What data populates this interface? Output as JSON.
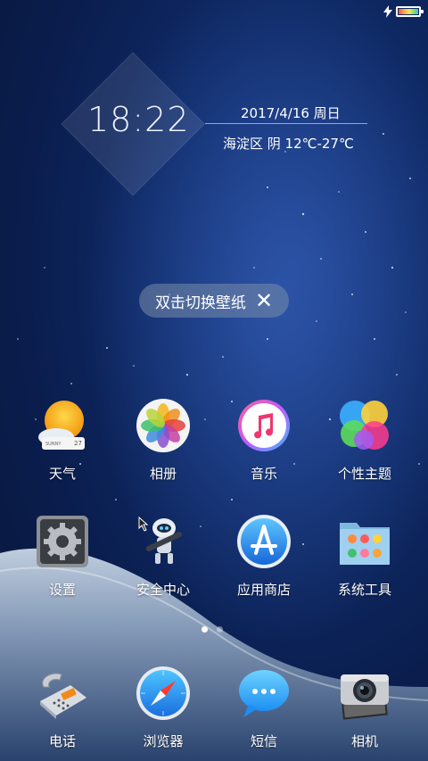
{
  "status_bar": {
    "charging_icon": "lightning-icon",
    "battery_icon": "battery-icon"
  },
  "clock_widget": {
    "time": "18:22",
    "date": "2017/4/16 周日",
    "weather": "海淀区 阴 12℃-27℃"
  },
  "toast": {
    "label": "双击切换壁纸",
    "close_icon": "close-icon"
  },
  "apps": [
    {
      "label": "天气",
      "icon": "weather-icon"
    },
    {
      "label": "相册",
      "icon": "photos-icon"
    },
    {
      "label": "音乐",
      "icon": "music-icon"
    },
    {
      "label": "个性主题",
      "icon": "themes-icon"
    },
    {
      "label": "设置",
      "icon": "settings-icon"
    },
    {
      "label": "安全中心",
      "icon": "security-icon"
    },
    {
      "label": "应用商店",
      "icon": "app-store-icon"
    },
    {
      "label": "系统工具",
      "icon": "tools-folder-icon"
    }
  ],
  "page_indicator": {
    "pages": 2,
    "active": 1
  },
  "dock": [
    {
      "label": "电话",
      "icon": "phone-icon"
    },
    {
      "label": "浏览器",
      "icon": "browser-icon"
    },
    {
      "label": "短信",
      "icon": "messages-icon"
    },
    {
      "label": "相机",
      "icon": "camera-icon"
    }
  ]
}
